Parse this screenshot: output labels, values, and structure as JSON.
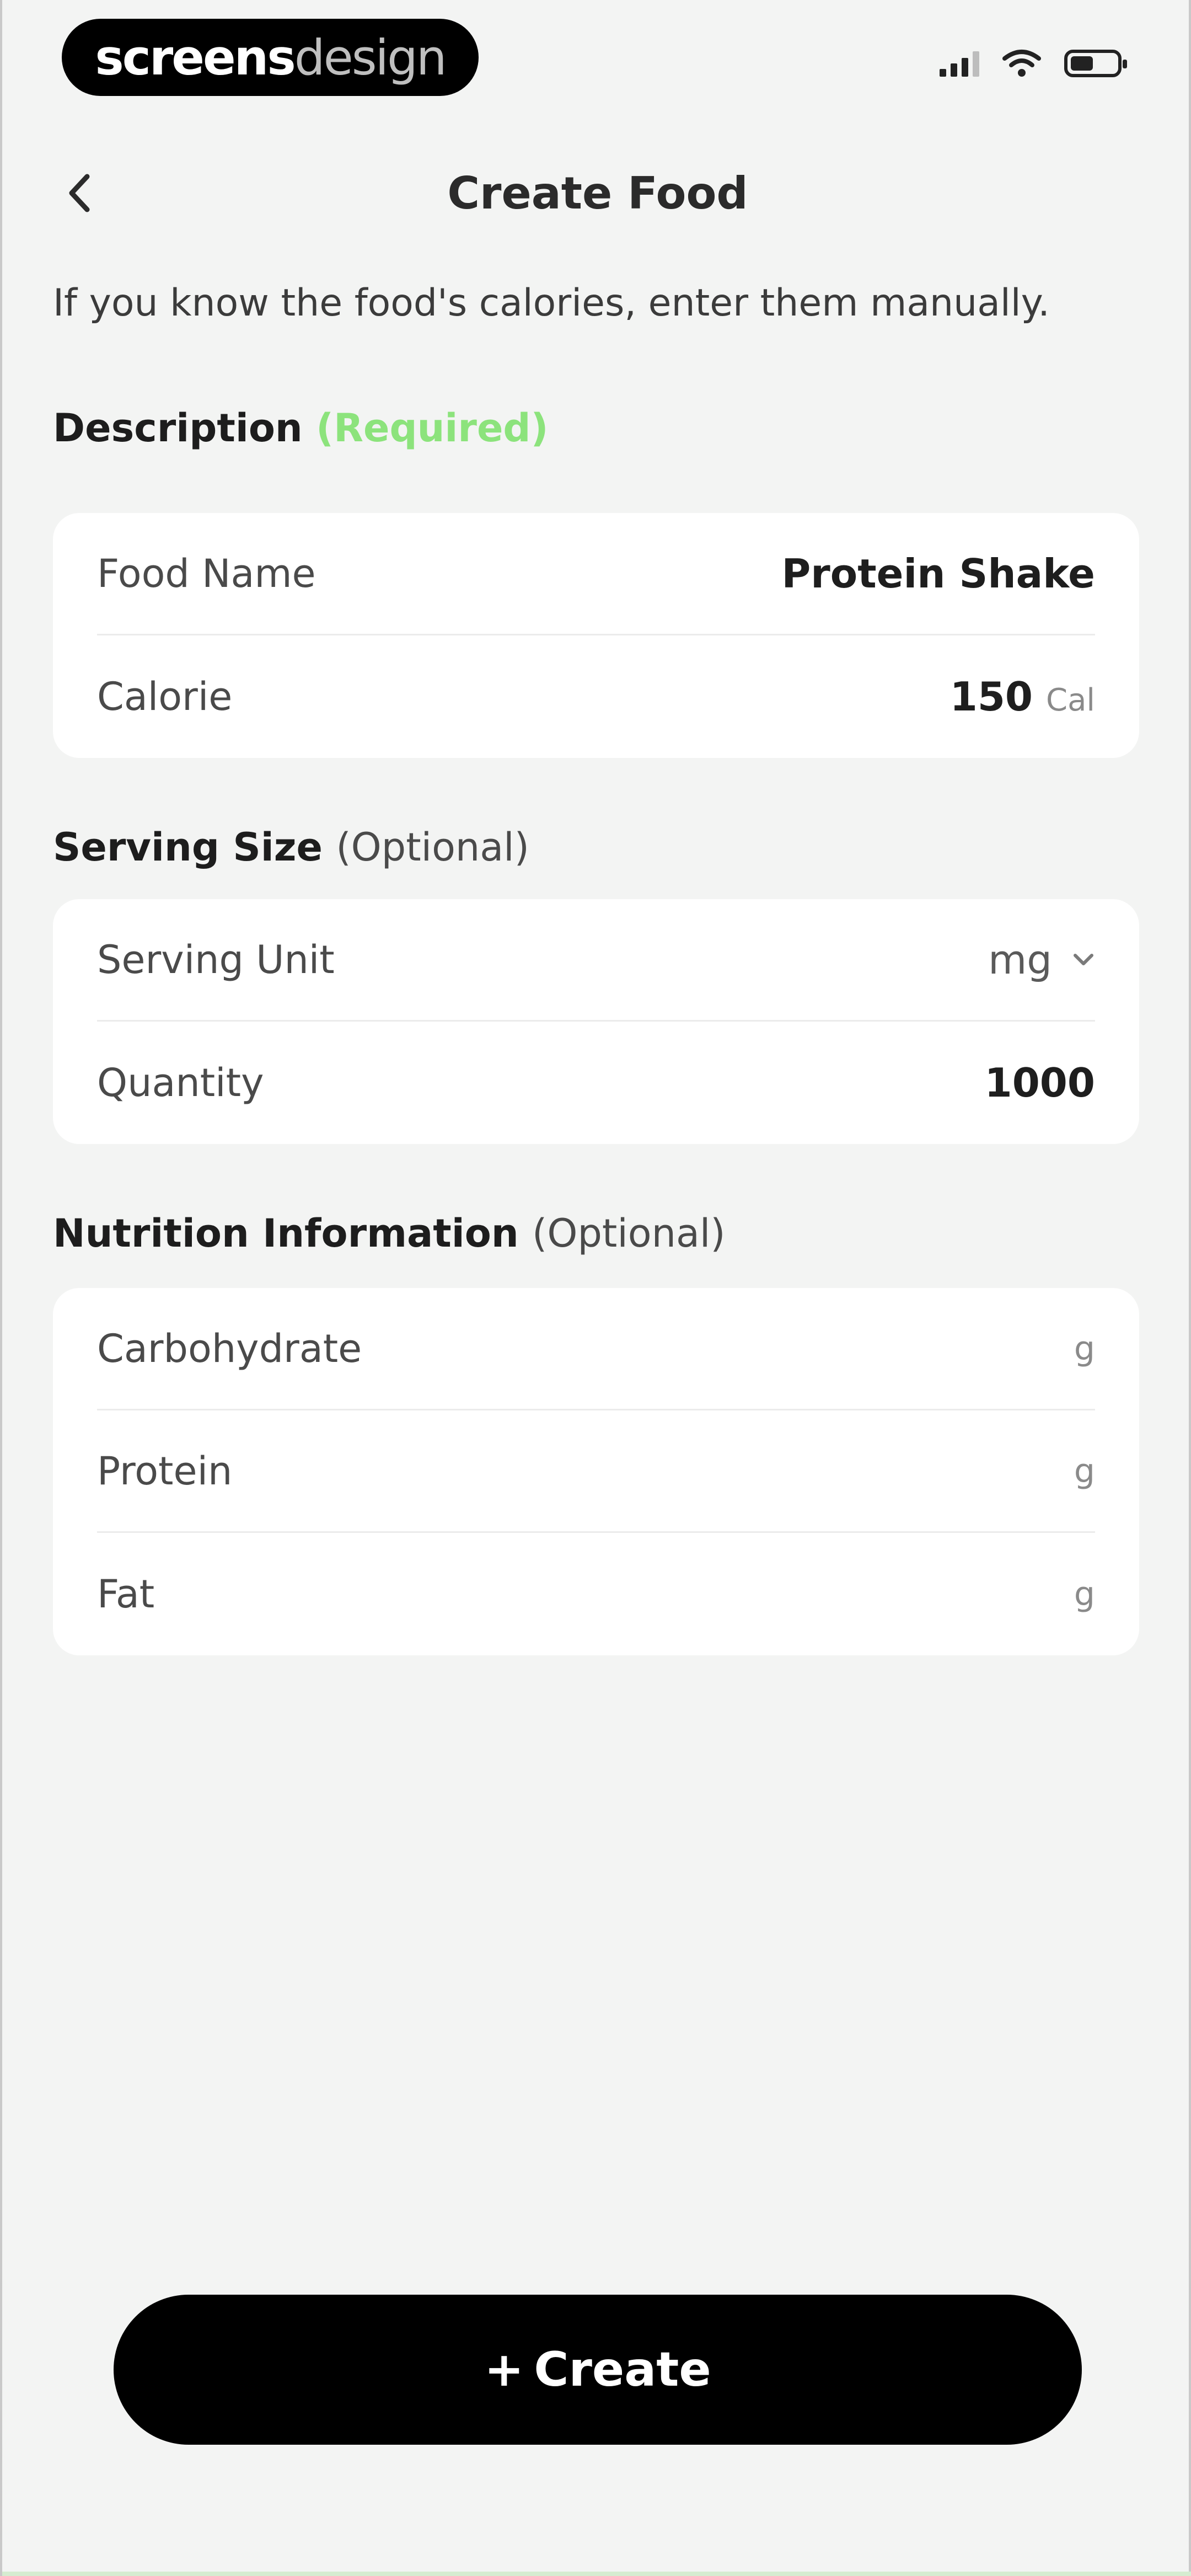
{
  "status_bar": {
    "brand_bold": "screens",
    "brand_light": "design"
  },
  "header": {
    "title": "Create Food"
  },
  "intro": {
    "text": "If you know the food's calories, enter them manually."
  },
  "description": {
    "title": "Description",
    "note": "(Required)",
    "rows": [
      {
        "label": "Food Name",
        "value": "Protein Shake"
      },
      {
        "label": "Calorie",
        "value": "150",
        "unit": "Cal"
      }
    ]
  },
  "serving": {
    "title": "Serving Size",
    "note": "(Optional)",
    "rows": [
      {
        "label": "Serving Unit",
        "value": "mg"
      },
      {
        "label": "Quantity",
        "value": "1000"
      }
    ]
  },
  "nutrition": {
    "title": "Nutrition Information",
    "note": "(Optional)",
    "rows": [
      {
        "label": "Carbohydrate",
        "unit": "g"
      },
      {
        "label": "Protein",
        "unit": "g"
      },
      {
        "label": "Fat",
        "unit": "g"
      }
    ]
  },
  "actions": {
    "create_label": "Create",
    "create_icon": "plus-icon"
  },
  "colors": {
    "required_note": "#8ce37c",
    "primary_button": "#000000",
    "card_background": "#ffffff",
    "page_background": "#f3f4f3"
  }
}
